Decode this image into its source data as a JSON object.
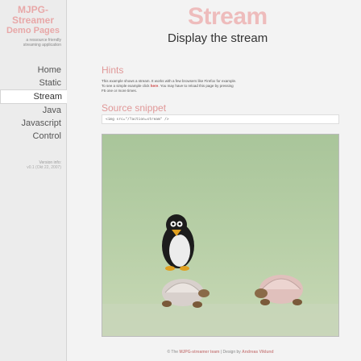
{
  "site": {
    "title_line1": "MJPG-Streamer",
    "title_line2": "Demo Pages",
    "tagline_line1": "a ressource friendly",
    "tagline_line2": "streaming application"
  },
  "nav": [
    {
      "label": "Home",
      "active": false
    },
    {
      "label": "Static",
      "active": false
    },
    {
      "label": "Stream",
      "active": true
    },
    {
      "label": "Java",
      "active": false
    },
    {
      "label": "Javascript",
      "active": false
    },
    {
      "label": "Control",
      "active": false
    }
  ],
  "version": {
    "label": "Version info:",
    "value": "v0.1 (Okt 22, 2007)"
  },
  "page": {
    "big_title": "Stream",
    "heading": "Display the stream"
  },
  "hints": {
    "heading": "Hints",
    "line1": "This example shows a stream. It works with a few browsers like Firefox for example.",
    "line2_prefix": "To see a simple example click",
    "link": "here",
    "line2_suffix": ". You may have to reload this page by pressing",
    "line3": "F5 one or more times."
  },
  "source": {
    "heading": "Source snippet",
    "code": "<img src=\"/?action=stream\" />"
  },
  "footer": {
    "prefix": "© The",
    "team_link": "MJPG-streamer team",
    "middle": " | Design by",
    "designer": "Andreas Viklund"
  }
}
